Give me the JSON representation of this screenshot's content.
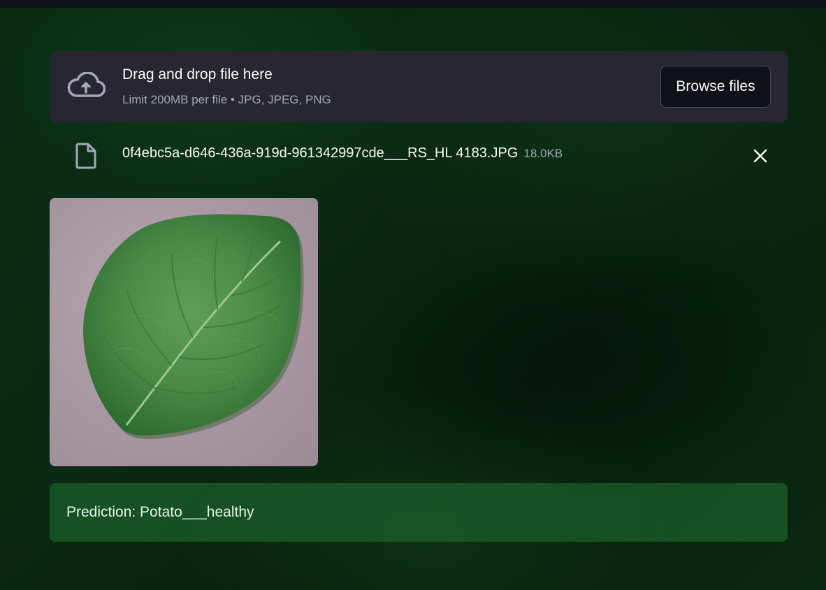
{
  "uploader": {
    "title": "Drag and drop file here",
    "subtitle": "Limit 200MB per file • JPG, JPEG, PNG",
    "browse_label": "Browse files",
    "icon": "cloud-upload-icon"
  },
  "file": {
    "name": "0f4ebc5a-d646-436a-919d-961342997cde___RS_HL 4183.JPG",
    "size": "18.0KB",
    "icon": "file-icon",
    "remove_icon": "close-icon"
  },
  "prediction": {
    "text": "Prediction: Potato___healthy"
  },
  "colors": {
    "background": "#0a2a14",
    "panel": "#262730",
    "prediction_bg": "#1e5e2c",
    "text": "#fafafa",
    "muted": "#a3a8b4"
  }
}
